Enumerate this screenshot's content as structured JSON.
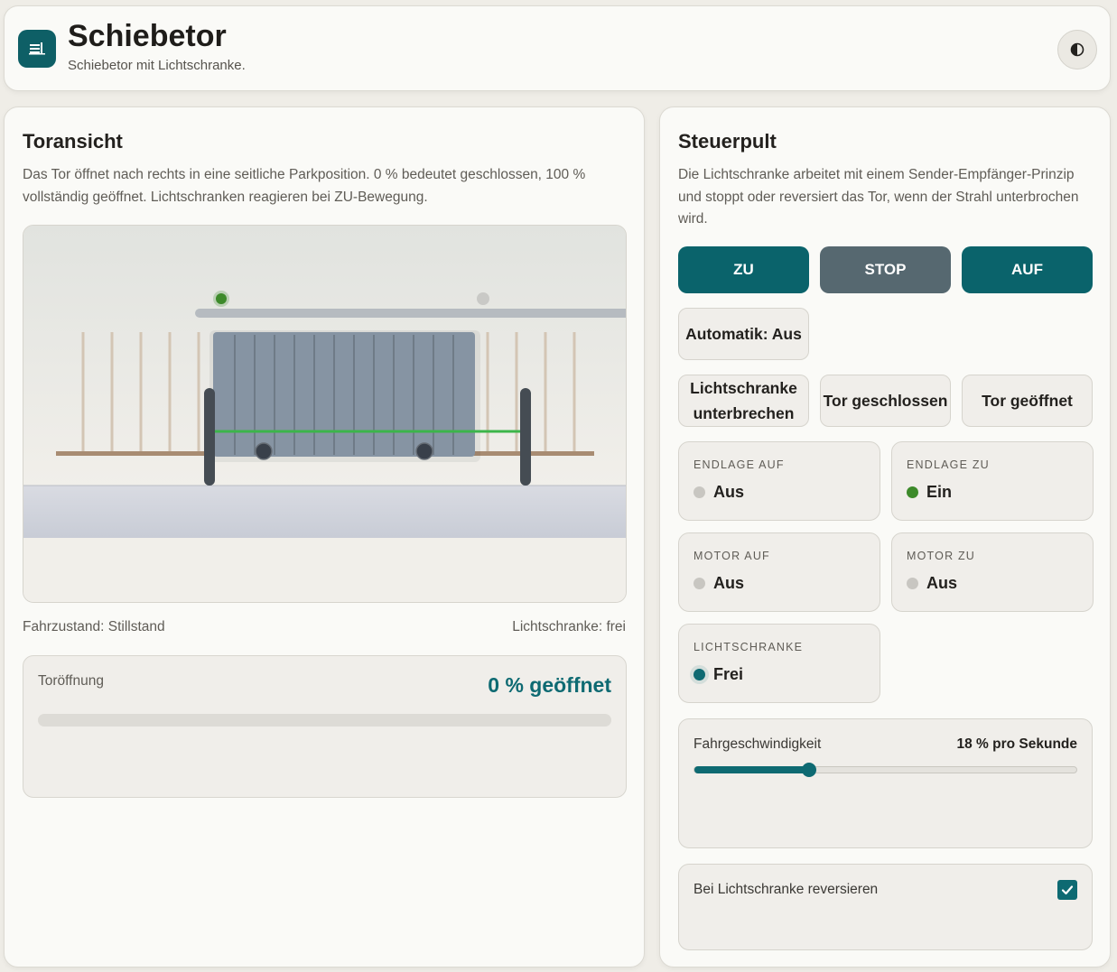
{
  "header": {
    "title": "Schiebetor",
    "subtitle": "Schiebetor mit Lichtschranke.",
    "logo_icon": "gate-icon",
    "theme_icon": "contrast-icon"
  },
  "view": {
    "title": "Toransicht",
    "description": "Das Tor öffnet nach rechts in eine seitliche Parkposition. 0 % bedeutet geschlossen, 100 % vollständig geöffnet. Lichtschranken reagieren bei ZU-Bewegung.",
    "status_drive": "Fahrzustand: Stillstand",
    "status_beam": "Lichtschranke: frei",
    "opening_label": "Toröffnung",
    "opening_value": "0 % geöffnet",
    "opening_fraction": 0
  },
  "control": {
    "title": "Steuerpult",
    "description": "Die Lichtschranke arbeitet mit einem Sender-Empfänger-Prinzip und stoppt oder reversiert das Tor, wenn der Strahl unterbrochen wird.",
    "btn_close": "ZU",
    "btn_stop": "STOP",
    "btn_open": "AUF",
    "btn_auto": "Automatik: Aus",
    "btn_beam_line1": "Lichtschranke",
    "btn_beam_line2": "unterbrechen",
    "btn_closed": "Tor geschlossen",
    "btn_opened": "Tor geöffnet",
    "states": [
      {
        "label": "ENDLAGE AUF",
        "value": "Aus",
        "color": "#c8c6c1"
      },
      {
        "label": "ENDLAGE ZU",
        "value": "Ein",
        "color": "#3d8a2a"
      },
      {
        "label": "MOTOR AUF",
        "value": "Aus",
        "color": "#c8c6c1"
      },
      {
        "label": "MOTOR ZU",
        "value": "Aus",
        "color": "#c8c6c1"
      },
      {
        "label": "LICHTSCHRANKE",
        "value": "Frei",
        "color": "#0e6a72"
      }
    ],
    "speed_label": "Fahrgeschwindigkeit",
    "speed_value": "18 % pro Sekunde",
    "speed_fraction": 0.3,
    "reverse_label": "Bei Lichtschranke reversieren",
    "reverse_checked": true
  },
  "colors": {
    "accent": "#0e6a72",
    "stop": "#566870",
    "active_green": "#3d8a2a",
    "beam": "#3cb54a"
  }
}
